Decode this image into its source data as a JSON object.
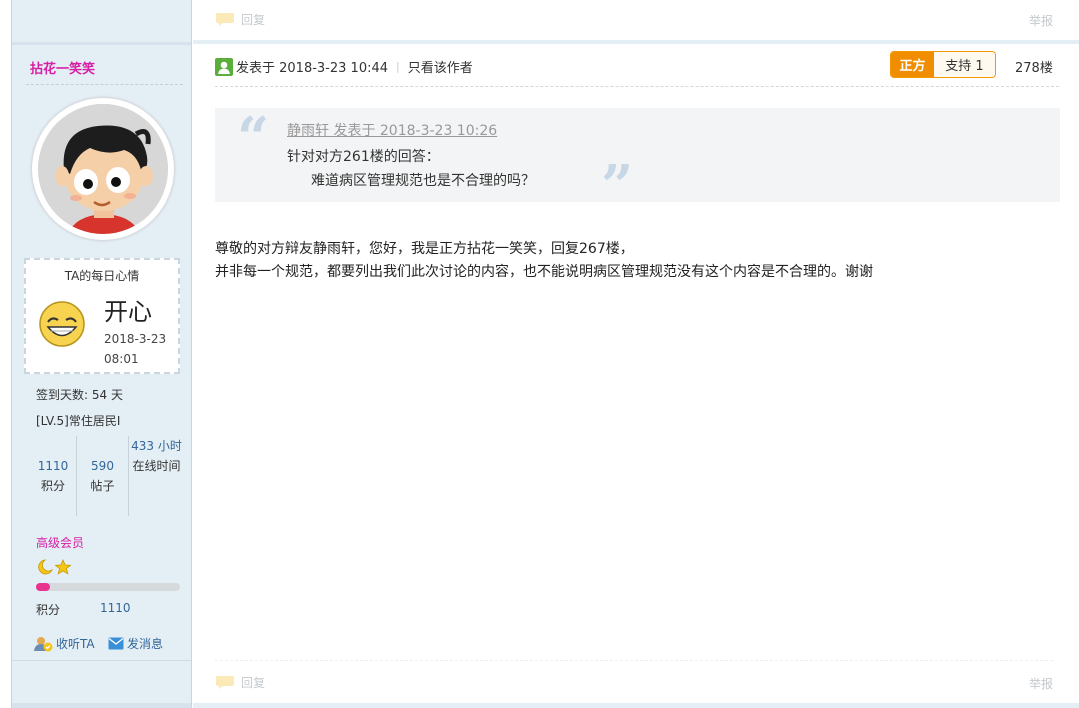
{
  "top_reply": {
    "reply_label": "回复",
    "report_label": "举报"
  },
  "author": {
    "name": "拈花一笑笑",
    "mood": {
      "title": "TA的每日心情",
      "text": "开心",
      "date": "2018-3-23",
      "time": "08:01"
    },
    "signin": "签到天数: 54 天",
    "level": "[LV.5]常住居民I",
    "stats": [
      {
        "value": "1110",
        "label": "积分"
      },
      {
        "value": "590",
        "label": "帖子"
      },
      {
        "value": "433 小时",
        "label": "在线时间"
      }
    ],
    "member_group": "高级会员",
    "points_label": "积分",
    "points_value": "1110",
    "points_progress": 0.1,
    "follow_label": "收听TA",
    "message_label": "发消息"
  },
  "post": {
    "posted": "发表于 2018-3-23 10:44",
    "only_author": "只看该作者",
    "side": "正方",
    "support": "支持 1",
    "floor": "278楼",
    "quote": {
      "author_line": "静雨轩 发表于 2018-3-23 10:26",
      "line1": "针对对方261楼的回答：",
      "line2": "难道病区管理规范也是不合理的吗？"
    },
    "body_line1": "尊敬的对方辩友静雨轩，您好，我是正方拈花一笑笑，回复267楼，",
    "body_line2": "并非每一个规范，都要列出我们此次讨论的内容，也不能说明病区管理规范没有这个内容是不合理的。谢谢"
  },
  "bottom_reply": {
    "reply_label": "回复",
    "report_label": "举报"
  },
  "colors": {
    "accent_pink": "#d81ea5",
    "link_blue": "#336699",
    "side_orange": "#f18d00",
    "sidebar_bg": "#e4eef5"
  }
}
